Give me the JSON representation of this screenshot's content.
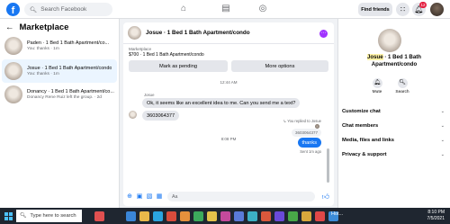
{
  "topbar": {
    "logo": "f",
    "search_placeholder": "Search Facebook",
    "find_friends": "Find friends",
    "notif_count": "12"
  },
  "left": {
    "title": "Marketplace",
    "conversations": [
      {
        "name": "Paden · 1 Bed 1 Bath Apartment/co...",
        "sub": "You: thanks · 1m"
      },
      {
        "name": "Josue · 1 Bed 1 Bath Apartment/condo",
        "sub": "You: thanks · 1m"
      },
      {
        "name": "Donancy · 1 Bed 1 Bath Apartment/co...",
        "sub": "Donancy Rene Ruiz left the group. · 2d"
      }
    ]
  },
  "chat": {
    "title": "Josue · 1 Bed 1 Bath Apartment/condo",
    "marketplace_label": "Marketplace",
    "listing": "$700 · 1 Bed 1 Bath Apartment/condo",
    "mark_pending": "Mark as pending",
    "more_options": "More options",
    "ts1": "12:44 AM",
    "sender": "Josue",
    "msg1": "Ok, it seems like an excellent idea to me. Can you send me a text?",
    "msg2": "3603064377",
    "ts2": "8:08 PM",
    "replied": "You replied to Josue",
    "quoted": "3603064377",
    "msg_out": "thanks",
    "sent": "Sent 1m ago",
    "composer_placeholder": "Aa"
  },
  "right": {
    "name_hl": "Josue",
    "name_rest": " · 1 Bed 1 Bath Apartment/condo",
    "mute": "Mute",
    "search": "Search",
    "rows": [
      "Customize chat",
      "Chat members",
      "Media, files and links",
      "Privacy & support"
    ]
  },
  "taskbar": {
    "search_placeholder": "Type here to search",
    "hot": "Hot...",
    "time": "8:10 PM",
    "date": "7/5/2021"
  }
}
